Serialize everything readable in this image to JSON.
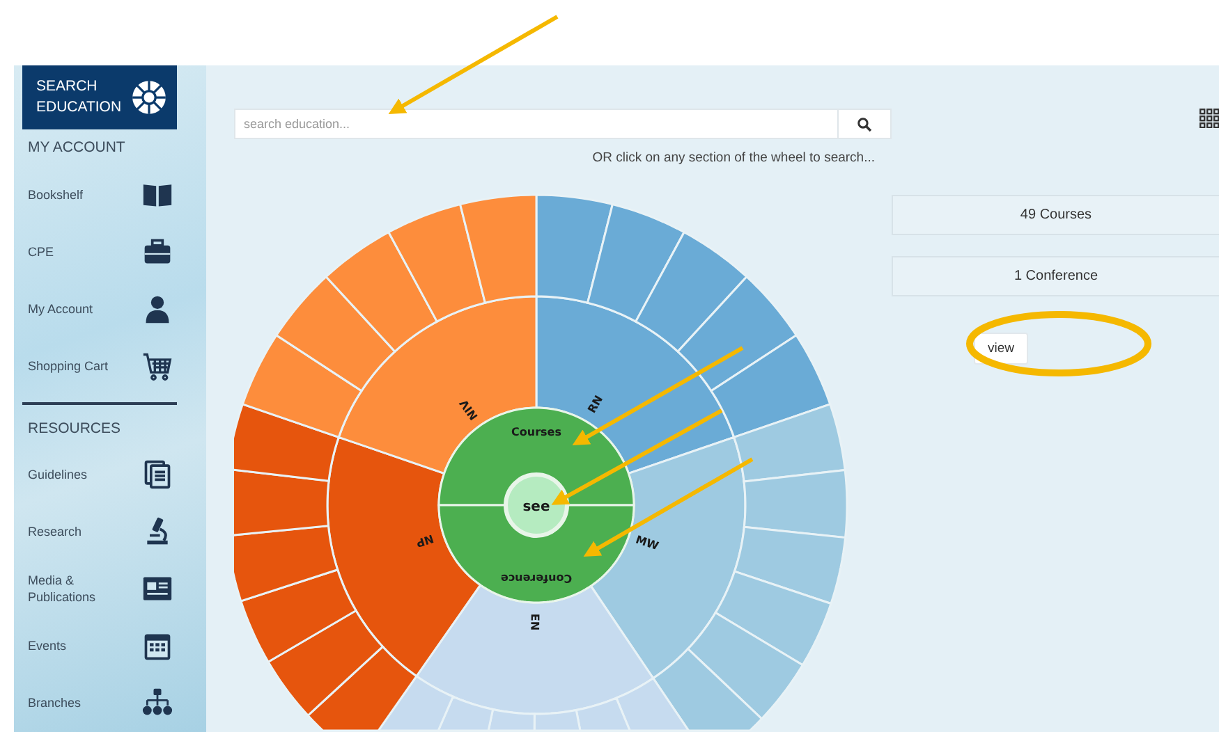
{
  "sidebar": {
    "title": "SEARCH EDUCATION",
    "sections": [
      {
        "heading": "MY ACCOUNT",
        "items": [
          {
            "label": "Bookshelf"
          },
          {
            "label": "CPE"
          },
          {
            "label": "My Account"
          },
          {
            "label": "Shopping Cart"
          }
        ]
      },
      {
        "heading": "RESOURCES",
        "items": [
          {
            "label": "Guidelines"
          },
          {
            "label": "Research"
          },
          {
            "label": "Media & Publications"
          },
          {
            "label": "Events"
          },
          {
            "label": "Branches"
          }
        ]
      }
    ]
  },
  "search": {
    "placeholder": "search education..."
  },
  "hint": "OR click on any section of the wheel to search...",
  "wheel": {
    "center": "see",
    "inner": [
      {
        "label": "Courses"
      },
      {
        "label": "Conference"
      }
    ],
    "segments": [
      {
        "label": "RN",
        "color": "#6aabd6"
      },
      {
        "label": "MW",
        "color": "#9ecae1"
      },
      {
        "label": "EN",
        "color": "#c6dbef"
      },
      {
        "label": "NP",
        "color": "#e6550d"
      },
      {
        "label": "NIV",
        "color": "#fd8d3c"
      }
    ]
  },
  "results": [
    "49 Courses",
    "1 Conference"
  ],
  "view_button": "view"
}
